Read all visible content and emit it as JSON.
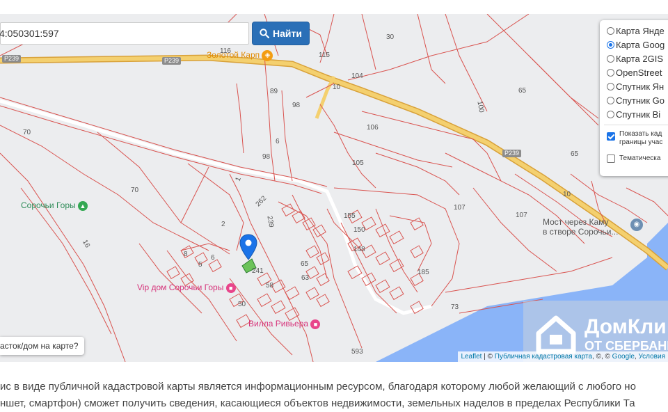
{
  "search": {
    "value": "4:050301:597",
    "button_label": "Найти"
  },
  "layers": {
    "items": [
      {
        "label": "Карта Янде",
        "selected": false
      },
      {
        "label": "Карта Goog",
        "selected": true
      },
      {
        "label": "Карта 2GIS",
        "selected": false
      },
      {
        "label": "OpenStreet",
        "selected": false
      },
      {
        "label": "Спутник Ян",
        "selected": false
      },
      {
        "label": "Спутник Go",
        "selected": false
      },
      {
        "label": "Спутник Bi",
        "selected": false
      }
    ],
    "overlays": [
      {
        "label_line1": "Показать кад",
        "label_line2": "границы учас",
        "checked": true
      },
      {
        "label_line1": "Тематическа",
        "label_line2": "",
        "checked": false
      }
    ]
  },
  "map": {
    "roads": [
      "P239",
      "P239",
      "P239"
    ],
    "pois": {
      "zolotoy_karp": "Золотой Карп",
      "sorochyi_gory": "Сорочьи Горы",
      "vip_dom": "Vip дом Сорочьи Горы",
      "villa": "Вилла Ривьера",
      "bridge_line1": "Мост через Каму",
      "bridge_line2": "в створе Сорочьи..."
    },
    "parcel_numbers": [
      "116",
      "115",
      "30",
      "104",
      "10",
      "89",
      "98",
      "65",
      "100",
      "70",
      "6",
      "106",
      "98",
      "105",
      "1",
      "65",
      "70",
      "262",
      "107",
      "107",
      "10",
      "2",
      "239",
      "155",
      "150",
      "16",
      "8",
      "5",
      "6",
      "148",
      "241",
      "65",
      "63",
      "185",
      "50",
      "58",
      "73",
      "593"
    ],
    "help_button": "асток/дом на карте?",
    "attribution": {
      "leaflet": "Leaflet",
      "sep": "|",
      "copy": "©",
      "pkk": "Публичная кадастровая карта",
      "rest": ", ©, © ",
      "google": "Google",
      "terms": "Условия"
    },
    "watermark": {
      "brand": "ДомКли",
      "sub": "ОТ СБЕРБАНК"
    }
  },
  "description": {
    "line1": "ис в виде публичной кадастровой карты является информационным ресурсом, благодаря которому любой желающий с любого но",
    "line2": "ншет, смартфон) сможет получить сведения, касающиеся объектов недвижимости, земельных наделов в пределах Республики Та"
  },
  "colors": {
    "parcel_line": "#d9534f",
    "highway": "#f0c24b",
    "water": "#8ab4f8",
    "search_button": "#2a6fb7",
    "marker": "#1a73e8"
  }
}
